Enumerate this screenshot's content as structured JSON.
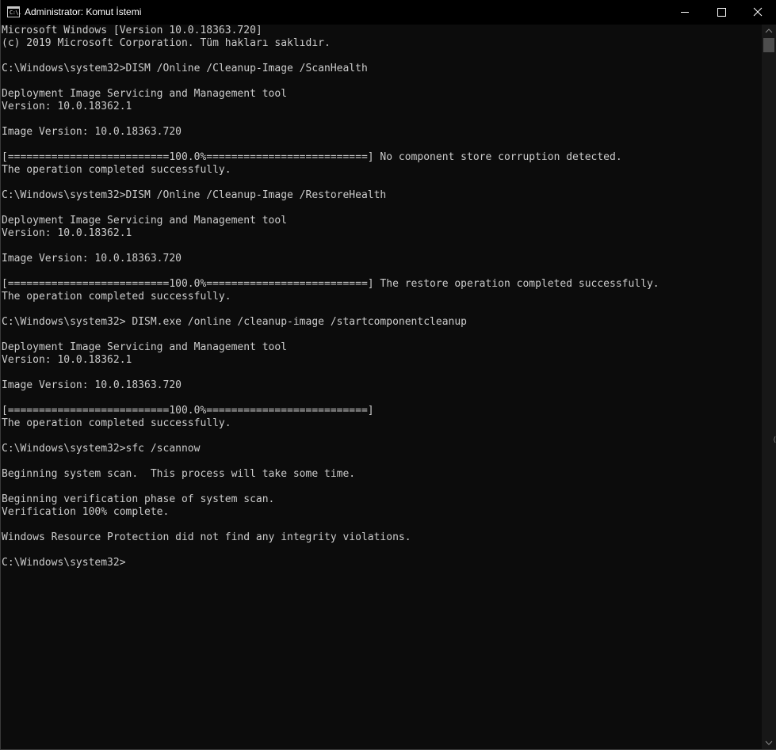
{
  "window": {
    "title": "Administrator: Komut İstemi",
    "icon_label": "C:\\."
  },
  "controls": {
    "minimize": "minimize-icon",
    "maximize": "maximize-icon",
    "close": "close-icon"
  },
  "console": {
    "lines": [
      "Microsoft Windows [Version 10.0.18363.720]",
      "(c) 2019 Microsoft Corporation. Tüm hakları saklıdır.",
      "",
      "C:\\Windows\\system32>DISM /Online /Cleanup-Image /ScanHealth",
      "",
      "Deployment Image Servicing and Management tool",
      "Version: 10.0.18362.1",
      "",
      "Image Version: 10.0.18363.720",
      "",
      "[==========================100.0%==========================] No component store corruption detected.",
      "The operation completed successfully.",
      "",
      "C:\\Windows\\system32>DISM /Online /Cleanup-Image /RestoreHealth",
      "",
      "Deployment Image Servicing and Management tool",
      "Version: 10.0.18362.1",
      "",
      "Image Version: 10.0.18363.720",
      "",
      "[==========================100.0%==========================] The restore operation completed successfully.",
      "The operation completed successfully.",
      "",
      "C:\\Windows\\system32> DISM.exe /online /cleanup-image /startcomponentcleanup",
      "",
      "Deployment Image Servicing and Management tool",
      "Version: 10.0.18362.1",
      "",
      "Image Version: 10.0.18363.720",
      "",
      "[==========================100.0%==========================]",
      "The operation completed successfully.",
      "",
      "C:\\Windows\\system32>sfc /scannow",
      "",
      "Beginning system scan.  This process will take some time.",
      "",
      "Beginning verification phase of system scan.",
      "Verification 100% complete.",
      "",
      "Windows Resource Protection did not find any integrity violations.",
      "",
      "C:\\Windows\\system32>"
    ]
  },
  "colors": {
    "background": "#0c0c0c",
    "text": "#cccccc",
    "titlebar": "#000000"
  }
}
